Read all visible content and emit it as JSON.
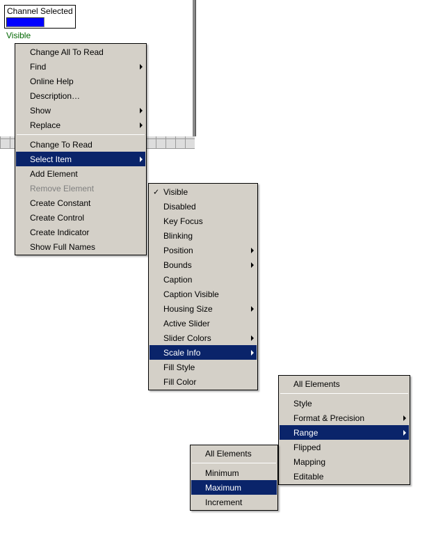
{
  "control": {
    "label": "Channel Selected",
    "visible_text": "Visible"
  },
  "menu1": {
    "items": [
      {
        "label": "Change All To Read"
      },
      {
        "label": "Find",
        "submenu": true
      },
      {
        "label": "Online Help"
      },
      {
        "label": "Description…"
      },
      {
        "label": "Show",
        "submenu": true
      },
      {
        "label": "Replace",
        "submenu": true
      },
      {
        "sep": true
      },
      {
        "label": "Change To Read"
      },
      {
        "label": "Select Item",
        "submenu": true,
        "highlighted": true
      },
      {
        "label": "Add Element"
      },
      {
        "label": "Remove Element",
        "disabled": true
      },
      {
        "label": "Create Constant"
      },
      {
        "label": "Create Control"
      },
      {
        "label": "Create Indicator"
      },
      {
        "label": "Show Full Names"
      }
    ]
  },
  "menu2": {
    "items": [
      {
        "label": "Visible",
        "checked": true
      },
      {
        "label": "Disabled"
      },
      {
        "label": "Key Focus"
      },
      {
        "label": "Blinking"
      },
      {
        "label": "Position",
        "submenu": true
      },
      {
        "label": "Bounds",
        "submenu": true
      },
      {
        "label": "Caption"
      },
      {
        "label": "Caption Visible"
      },
      {
        "label": "Housing Size",
        "submenu": true
      },
      {
        "label": "Active Slider"
      },
      {
        "label": "Slider Colors",
        "submenu": true
      },
      {
        "label": "Scale Info",
        "submenu": true,
        "highlighted": true
      },
      {
        "label": "Fill Style"
      },
      {
        "label": "Fill Color"
      }
    ]
  },
  "menu3": {
    "items": [
      {
        "label": "All Elements"
      },
      {
        "sep": true
      },
      {
        "label": "Style"
      },
      {
        "label": "Format & Precision",
        "submenu": true
      },
      {
        "label": "Range",
        "submenu": true,
        "highlighted": true
      },
      {
        "label": "Flipped"
      },
      {
        "label": "Mapping"
      },
      {
        "label": "Editable"
      }
    ]
  },
  "menu4": {
    "items": [
      {
        "label": "All Elements"
      },
      {
        "sep": true
      },
      {
        "label": "Minimum"
      },
      {
        "label": "Maximum",
        "highlighted": true
      },
      {
        "label": "Increment"
      }
    ]
  }
}
